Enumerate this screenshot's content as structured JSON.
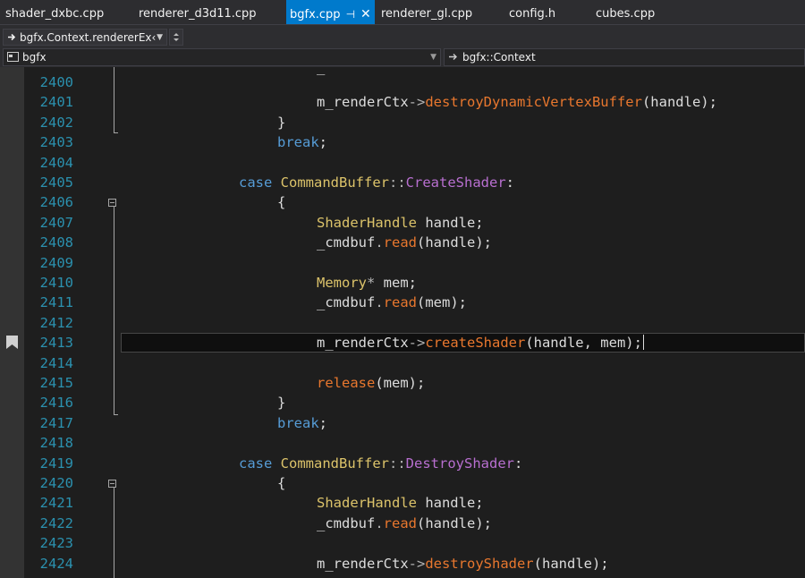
{
  "tabs": [
    {
      "label": "shader_dxbc.cpp",
      "active": false
    },
    {
      "label": "renderer_d3d11.cpp",
      "active": false
    },
    {
      "label": "bgfx.cpp",
      "active": true
    },
    {
      "label": "renderer_gl.cpp",
      "active": false
    },
    {
      "label": "config.h",
      "active": false
    },
    {
      "label": "cubes.cpp",
      "active": false
    }
  ],
  "toolbar": {
    "call_stack_value": "bgfx.Context.rendererEx‹",
    "pin_glyph": "⊣",
    "close_glyph": "✕"
  },
  "nav": {
    "scope": "bgfx",
    "member": "bgfx::Context"
  },
  "colors": {
    "accent": "#007acc",
    "line_number": "#2b91af",
    "keyword": "#569cd6",
    "type": "#dcc36a",
    "function": "#e8772e",
    "enum_member": "#b86fd0"
  },
  "editor": {
    "partial_top_text": "_",
    "line_numbers": [
      "2400",
      "2401",
      "2402",
      "2403",
      "2404",
      "2405",
      "2406",
      "2407",
      "2408",
      "2409",
      "2410",
      "2411",
      "2412",
      "2413",
      "2414",
      "2415",
      "2416",
      "2417",
      "2418",
      "2419",
      "2420",
      "2421",
      "2422",
      "2423",
      "2424"
    ],
    "lines": [
      {
        "t": []
      },
      {
        "t": [
          [
            "m_renderCtx",
            ""
          ],
          [
            "->",
            "pu"
          ],
          [
            "destroyDynamicVertexBuffer",
            "fn"
          ],
          [
            "(handle);",
            ""
          ]
        ]
      },
      {
        "t": [
          [
            "}",
            ""
          ]
        ]
      },
      {
        "t": [
          [
            "break",
            "kw"
          ],
          [
            ";",
            ""
          ]
        ]
      },
      {
        "t": []
      },
      {
        "t": [
          [
            "case ",
            "kw"
          ],
          [
            "CommandBuffer",
            "ty"
          ],
          [
            "::",
            "pu"
          ],
          [
            "CreateShader",
            "enum"
          ],
          [
            ":",
            ""
          ]
        ]
      },
      {
        "t": [
          [
            "{",
            ""
          ]
        ]
      },
      {
        "t": [
          [
            "ShaderHandle",
            "ty"
          ],
          [
            " handle;",
            ""
          ]
        ]
      },
      {
        "t": [
          [
            "_cmdbuf",
            ""
          ],
          [
            ".",
            "pu"
          ],
          [
            "read",
            "fn"
          ],
          [
            "(handle);",
            ""
          ]
        ]
      },
      {
        "t": []
      },
      {
        "t": [
          [
            "Memory",
            "ty"
          ],
          [
            "*",
            "pu"
          ],
          [
            " mem;",
            ""
          ]
        ]
      },
      {
        "t": [
          [
            "_cmdbuf",
            ""
          ],
          [
            ".",
            "pu"
          ],
          [
            "read",
            "fn"
          ],
          [
            "(mem);",
            ""
          ]
        ]
      },
      {
        "t": []
      },
      {
        "t": [
          [
            "m_renderCtx",
            ""
          ],
          [
            "->",
            "pu"
          ],
          [
            "createShader",
            "fn"
          ],
          [
            "(handle, mem);",
            ""
          ]
        ]
      },
      {
        "t": []
      },
      {
        "t": [
          [
            "release",
            "fn"
          ],
          [
            "(mem);",
            ""
          ]
        ]
      },
      {
        "t": [
          [
            "}",
            ""
          ]
        ]
      },
      {
        "t": [
          [
            "break",
            "kw"
          ],
          [
            ";",
            ""
          ]
        ]
      },
      {
        "t": []
      },
      {
        "t": [
          [
            "case ",
            "kw"
          ],
          [
            "CommandBuffer",
            "ty"
          ],
          [
            "::",
            "pu"
          ],
          [
            "DestroyShader",
            "enum"
          ],
          [
            ":",
            ""
          ]
        ]
      },
      {
        "t": [
          [
            "{",
            ""
          ]
        ]
      },
      {
        "t": [
          [
            "ShaderHandle",
            "ty"
          ],
          [
            " handle;",
            ""
          ]
        ]
      },
      {
        "t": [
          [
            "_cmdbuf",
            ""
          ],
          [
            ".",
            "pu"
          ],
          [
            "read",
            "fn"
          ],
          [
            "(handle);",
            ""
          ]
        ]
      },
      {
        "t": []
      },
      {
        "t": [
          [
            "m_renderCtx",
            ""
          ],
          [
            "->",
            "pu"
          ],
          [
            "destroyShader",
            "fn"
          ],
          [
            "(handle);",
            ""
          ]
        ]
      }
    ]
  }
}
